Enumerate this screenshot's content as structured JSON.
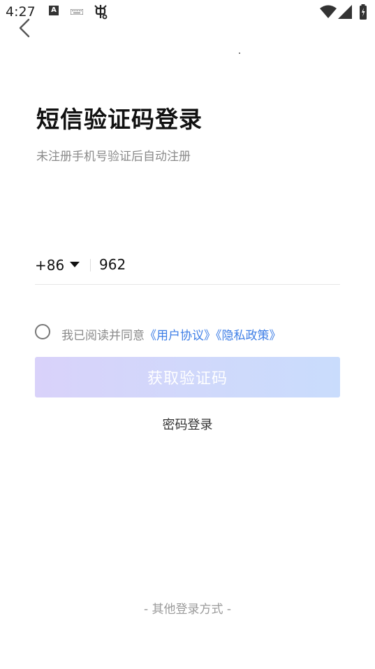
{
  "status_bar": {
    "time": "4:27",
    "a_label": "A",
    "icons": [
      "a-notification-icon",
      "keyboard-icon",
      "bug-icon",
      "wifi-icon",
      "signal-icon",
      "battery-charging-icon"
    ]
  },
  "nav": {
    "back_icon": "chevron-left-icon"
  },
  "main": {
    "title": "短信验证码登录",
    "subtitle": "未注册手机号验证后自动注册"
  },
  "phone": {
    "country_code": "+86",
    "value": "962",
    "caret_icon": "caret-down-icon"
  },
  "agreement": {
    "text": "我已阅读并同意",
    "user_agreement": "《用户协议》",
    "privacy_policy": "《隐私政策》",
    "checked": false
  },
  "actions": {
    "get_code_label": "获取验证码",
    "password_login_label": "密码登录"
  },
  "footer": {
    "other_login_label": "- 其他登录方式 -"
  },
  "colors": {
    "link": "#3e7ee6",
    "button_gradient_start": "#d9d2fa",
    "button_gradient_end": "#c9dcfc",
    "muted_text": "#8a8a8a"
  }
}
